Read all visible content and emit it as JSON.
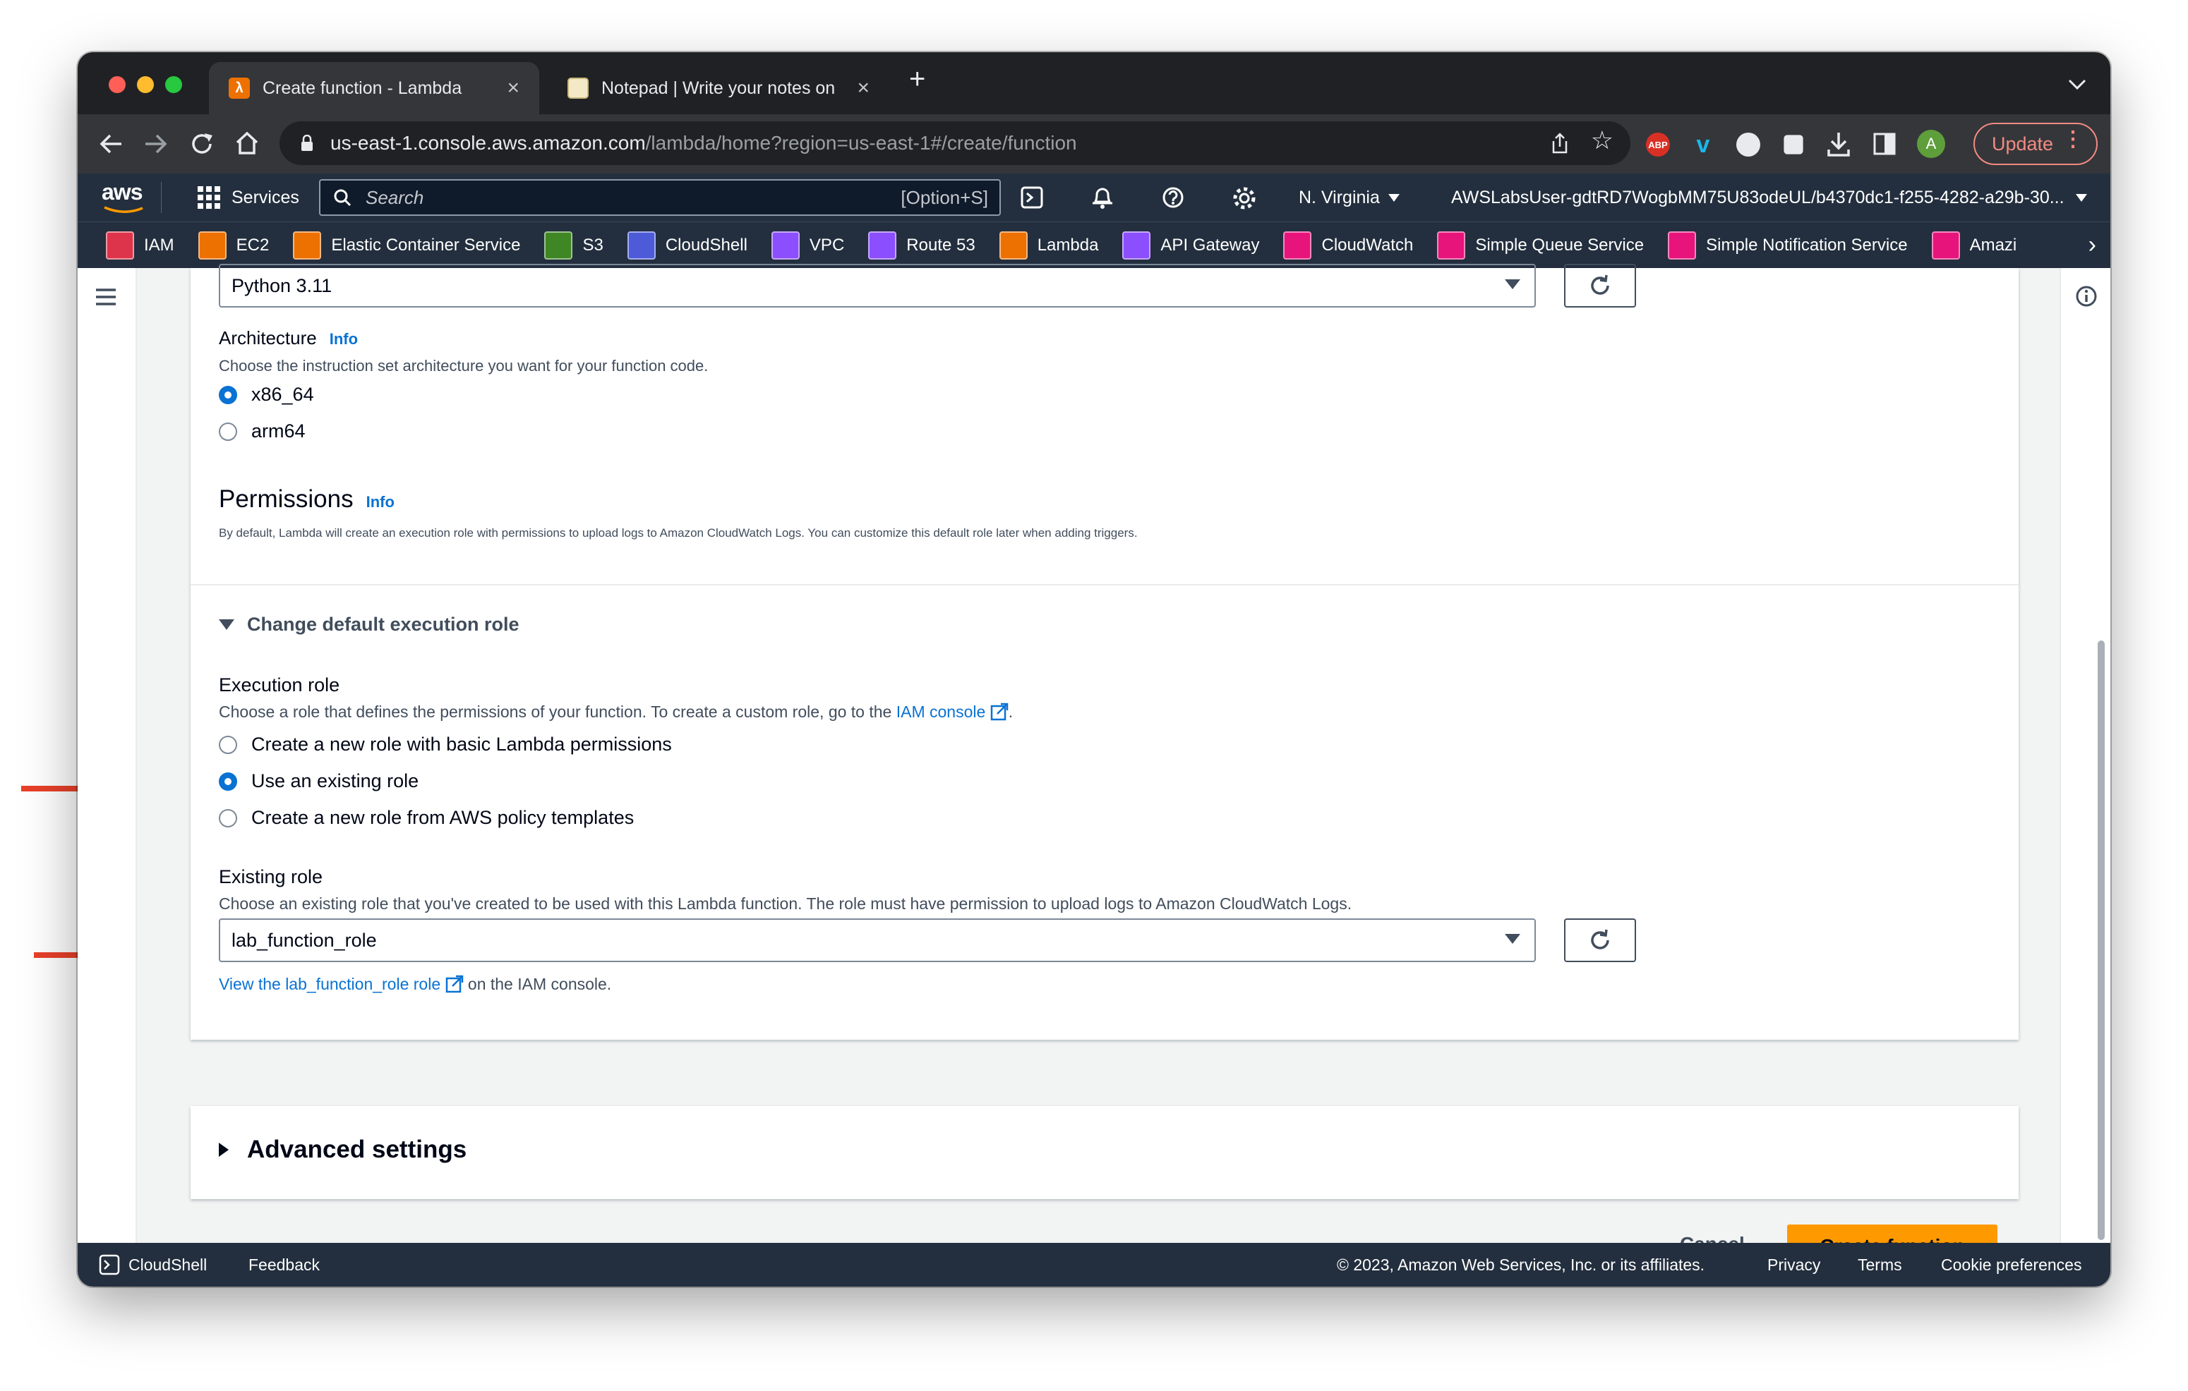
{
  "browser": {
    "tabs": [
      {
        "title": "Create function - Lambda"
      },
      {
        "title": "Notepad | Write your notes on"
      }
    ],
    "url_host": "us-east-1.console.aws.amazon.com",
    "url_path": "/lambda/home?region=us-east-1#/create/function",
    "update_label": "Update",
    "profile_initial": "A",
    "abp_label": "ABP"
  },
  "aws_nav": {
    "logo": "aws",
    "services_label": "Services",
    "search_placeholder": "Search",
    "search_shortcut": "[Option+S]",
    "region": "N. Virginia",
    "account": "AWSLabsUser-gdtRD7WogbMM75U83odeUL/b4370dc1-f255-4282-a29b-30..."
  },
  "bookmarks": [
    {
      "label": "IAM",
      "color": "#dd344c"
    },
    {
      "label": "EC2",
      "color": "#ed7100"
    },
    {
      "label": "Elastic Container Service",
      "color": "#ed7100"
    },
    {
      "label": "S3",
      "color": "#3f8624"
    },
    {
      "label": "CloudShell",
      "color": "#4d5bd9"
    },
    {
      "label": "VPC",
      "color": "#8c4fff"
    },
    {
      "label": "Route 53",
      "color": "#8c4fff"
    },
    {
      "label": "Lambda",
      "color": "#ed7100"
    },
    {
      "label": "API Gateway",
      "color": "#8c4fff"
    },
    {
      "label": "CloudWatch",
      "color": "#e7157b"
    },
    {
      "label": "Simple Queue Service",
      "color": "#e7157b"
    },
    {
      "label": "Simple Notification Service",
      "color": "#e7157b"
    },
    {
      "label": "Amazi",
      "color": "#e7157b"
    }
  ],
  "form": {
    "runtime_value": "Python 3.11",
    "architecture": {
      "label": "Architecture",
      "info": "Info",
      "description": "Choose the instruction set architecture you want for your function code.",
      "options": [
        "x86_64",
        "arm64"
      ],
      "selected": "x86_64"
    },
    "permissions": {
      "heading": "Permissions",
      "info": "Info",
      "description": "By default, Lambda will create an execution role with permissions to upload logs to Amazon CloudWatch Logs. You can customize this default role later when adding triggers."
    },
    "change_role_toggle": "Change default execution role",
    "execution_role": {
      "label": "Execution role",
      "description_prefix": "Choose a role that defines the permissions of your function. To create a custom role, go to the",
      "description_link": "IAM console",
      "description_suffix": ".",
      "options": [
        "Create a new role with basic Lambda permissions",
        "Use an existing role",
        "Create a new role from AWS policy templates"
      ],
      "selected": "Use an existing role"
    },
    "existing_role": {
      "label": "Existing role",
      "description": "Choose an existing role that you've created to be used with this Lambda function. The role must have permission to upload logs to Amazon CloudWatch Logs.",
      "value": "lab_function_role",
      "view_link": "View the lab_function_role role",
      "view_suffix": "on the IAM console."
    },
    "advanced_settings": "Advanced settings",
    "cancel_label": "Cancel",
    "create_label": "Create function"
  },
  "footer": {
    "cloudshell": "CloudShell",
    "feedback": "Feedback",
    "copyright": "© 2023, Amazon Web Services, Inc. or its affiliates.",
    "privacy": "Privacy",
    "terms": "Terms",
    "cookie": "Cookie preferences"
  },
  "colors": {
    "accent": "#0972d3",
    "primary_button": "#ff9900",
    "annotation_arrow": "#e8412a",
    "nav_bg": "#232f3e"
  }
}
